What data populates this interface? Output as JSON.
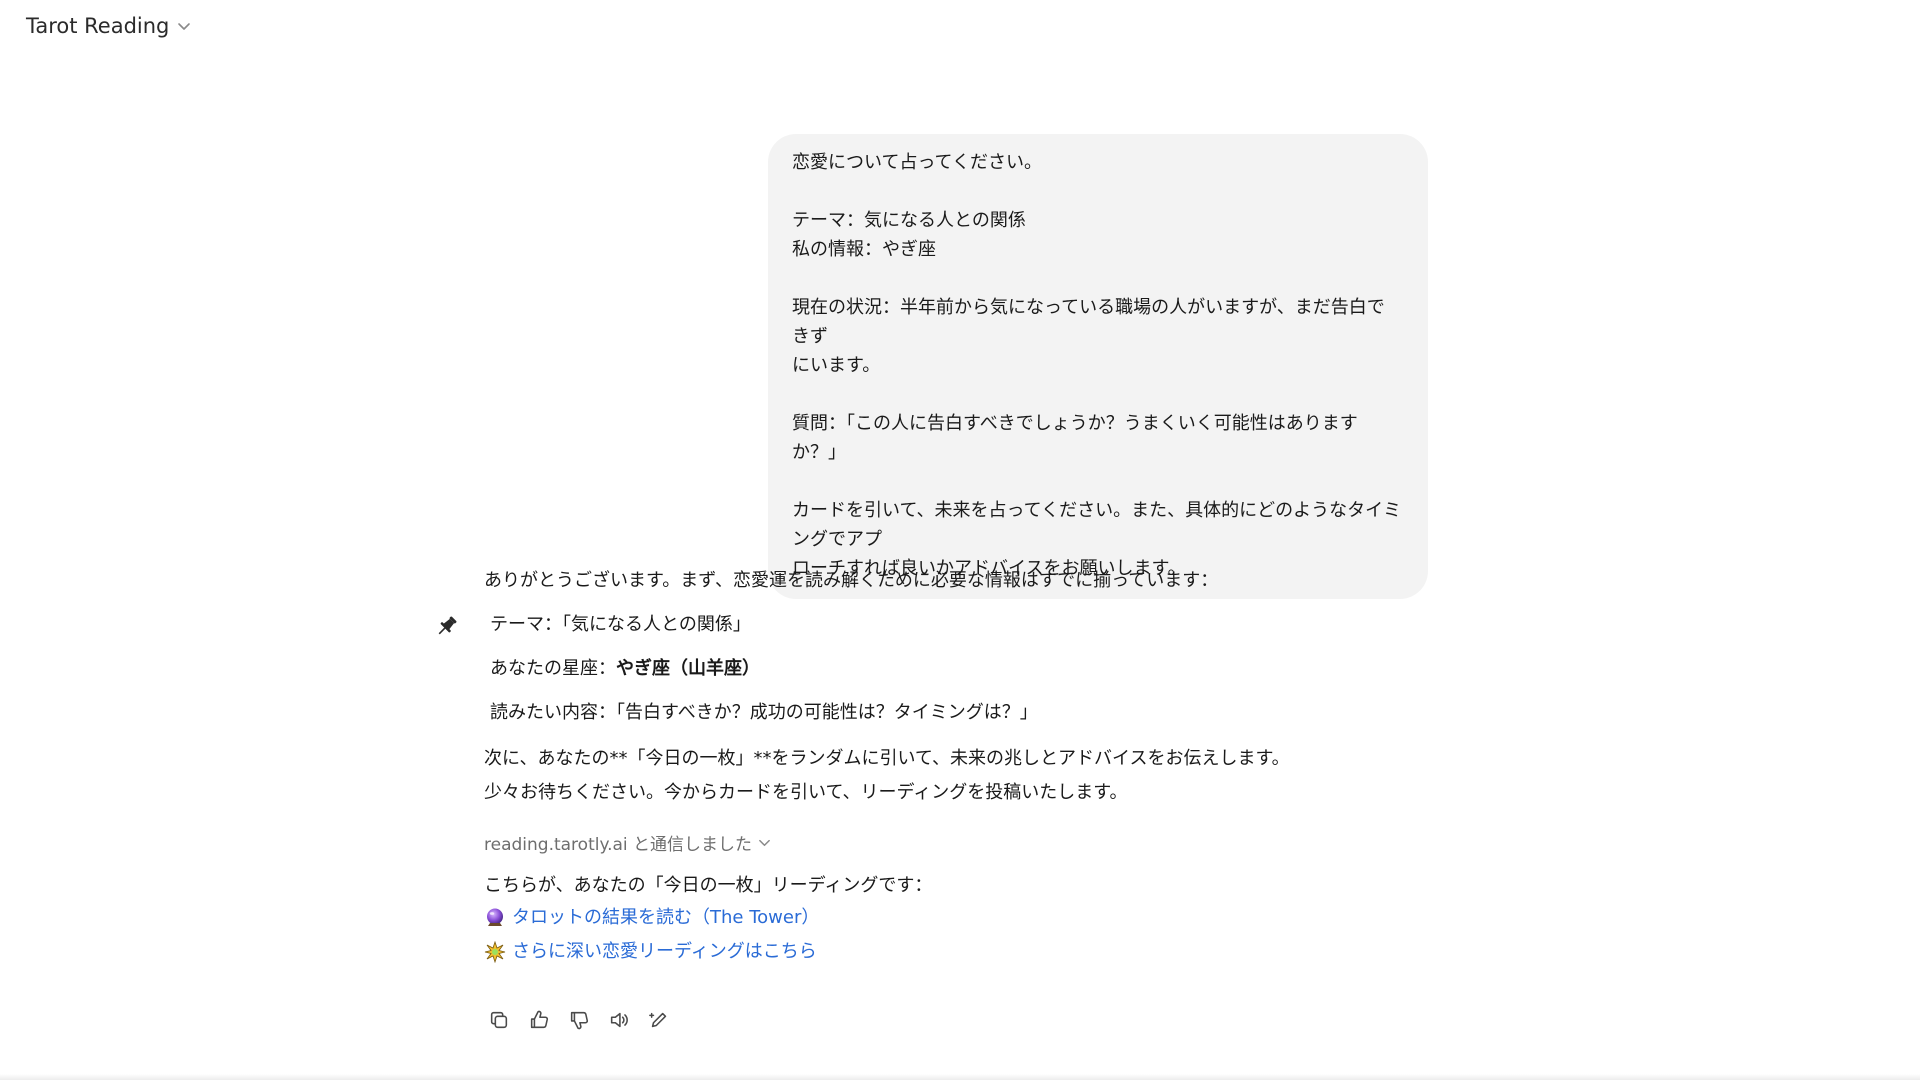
{
  "header": {
    "title": "Tarot Reading"
  },
  "user_message": {
    "lines": [
      "恋愛について占ってください。",
      "",
      "テーマ：気になる人との関係",
      "私の情報：やぎ座",
      "",
      "現在の状況：半年前から気になっている職場の人がいますが、まだ告白できず",
      "にいます。",
      "",
      "質問：「この人に告白すべきでしょうか？うまくいく可能性はありますか？」",
      "",
      "カードを引いて、未来を占ってください。また、具体的にどのようなタイミングでアプ",
      "ローチすれば良いかアドバイスをお願いします。"
    ]
  },
  "assistant": {
    "intro": "ありがとうございます。まず、恋愛運を読み解くために必要な情報はすでに揃っています：",
    "pin_items": {
      "theme": "テーマ：「気になる人との関係」",
      "sign_label": "あなたの星座：",
      "sign_value": "やぎ座（山羊座）",
      "want": "読みたい内容：「告白すべきか？成功の可能性は？タイミングは？」"
    },
    "para2_line1": "次に、あなたの**「今日の一枚」**をランダムに引いて、未来の兆しとアドバイスをお伝えします。",
    "para2_line2": "少々お待ちください。今からカードを引いて、リーディングを投稿いたします。",
    "tool_status": "reading.tarotly.ai と通信しました",
    "result_intro": "こちらが、あなたの「今日の一枚」リーディングです：",
    "links": {
      "result": "タロットの結果を読む（The Tower）",
      "deeper": "さらに深い恋愛リーディングはこちら"
    }
  },
  "icons": {
    "pin": "pushpin-icon",
    "crystal": "crystal-ball-icon",
    "sparkle": "sparkle-icon"
  },
  "colors": {
    "link": "#2a6bd6",
    "bubble": "#f3f3f3",
    "muted": "#6e6e6e"
  }
}
